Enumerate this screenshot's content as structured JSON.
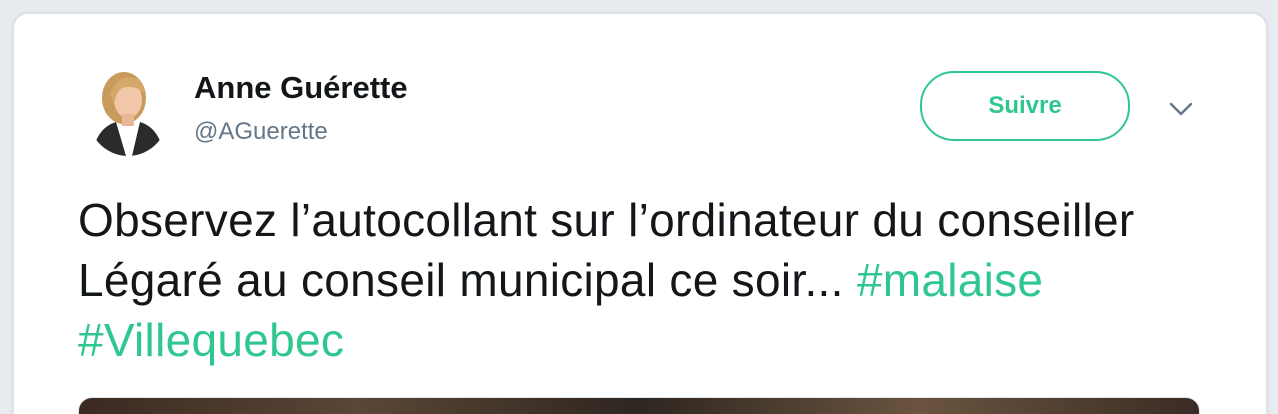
{
  "tweet": {
    "author": {
      "display_name": "Anne Guérette",
      "handle": "@AGuerette"
    },
    "follow_label": "Suivre",
    "text_main": "Observez l’autocollant sur l’ordinateur du conseiller Légaré au conseil municipal ce soir...",
    "hashtags": [
      "#malaise",
      "#Villequebec"
    ]
  },
  "icons": {
    "menu": "chevron-down-icon",
    "avatar": "profile-photo"
  },
  "colors": {
    "accent": "#2fc78f",
    "text": "#14171a",
    "secondary_text": "#657786",
    "background": "#e6ecf0"
  }
}
